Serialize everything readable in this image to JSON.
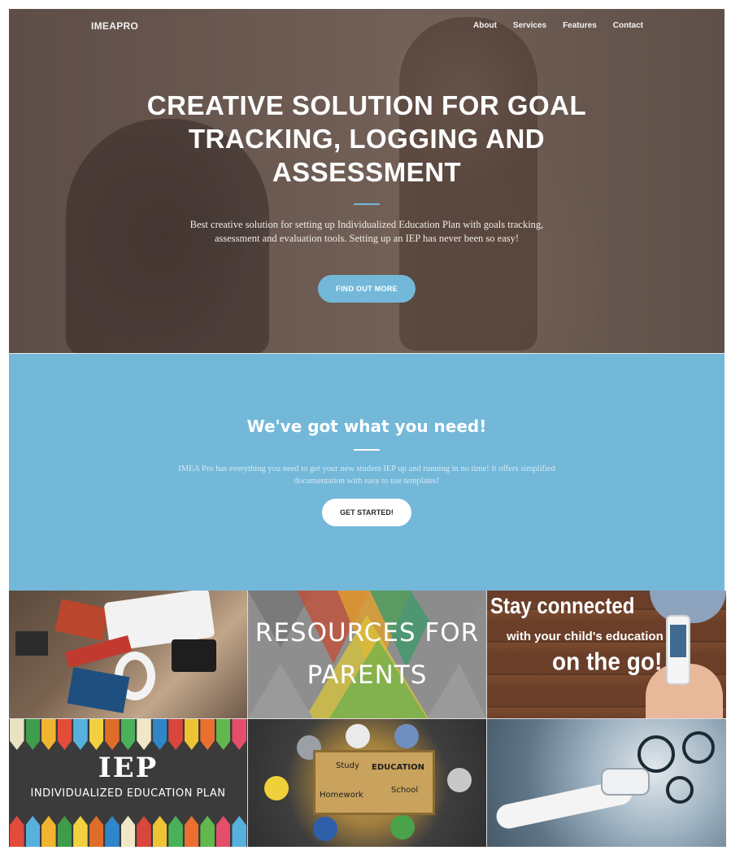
{
  "nav": {
    "brand": "IMEAPRO",
    "links": [
      "About",
      "Services",
      "Features",
      "Contact"
    ]
  },
  "hero": {
    "title": "CREATIVE SOLUTION FOR GOAL TRACKING, LOGGING AND ASSESSMENT",
    "text": "Best creative solution for setting up Individualized Education Plan with goals tracking, assessment and evaluation tools. Setting up an IEP has never been so easy!",
    "button": "FIND OUT MORE"
  },
  "about": {
    "title": "We've got what you need!",
    "text": "IMEA Pro has everything you need to get your new student IEP up and running in no time! It offers simplified documentation with easy to use templates!",
    "button": "GET STARTED!"
  },
  "portfolio": {
    "resources_line1": "RESOURCES FOR",
    "resources_line2": "PARENTS",
    "stay_line1": "Stay connected",
    "stay_line2": "with your child's education",
    "stay_line3": "on the go!",
    "iep_title": "IEP",
    "iep_subtitle": "INDIVIDUALIZED EDUCATION PLAN",
    "study": "Study",
    "education": "EDUCATION",
    "homework": "Homework",
    "school": "School"
  },
  "colors": {
    "accent": "#74b8d9",
    "section_bg": "#73b8d9"
  }
}
